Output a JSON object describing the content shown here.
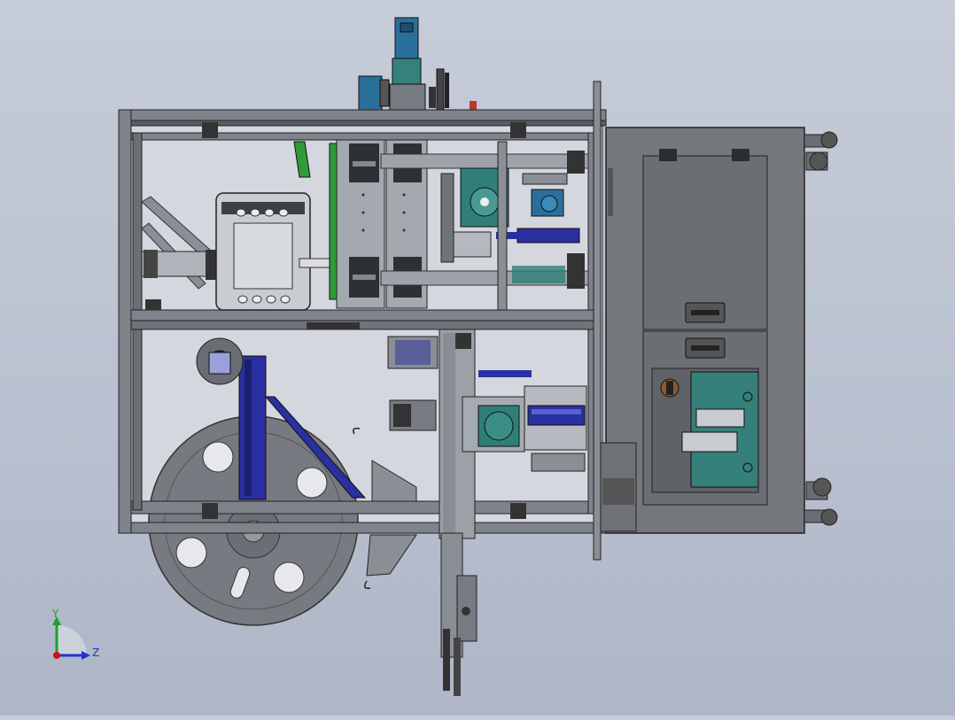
{
  "triad": {
    "y_label": "Y",
    "z_label": "Z",
    "y_color": "#1aa32a",
    "z_color": "#2233cc",
    "origin_color": "#cc1111"
  },
  "colors": {
    "background_top": "#c6ccd8",
    "frame_dark": "#3a3d42",
    "frame_mid": "#7c8088",
    "panel_fill": "#d2d6dc",
    "cabinet_fill": "#74777c",
    "accent_blue": "#2b2fa8",
    "accent_teal": "#2f7f78",
    "accent_green": "#2f9b3a",
    "motor_blue": "#2a6f9a"
  }
}
